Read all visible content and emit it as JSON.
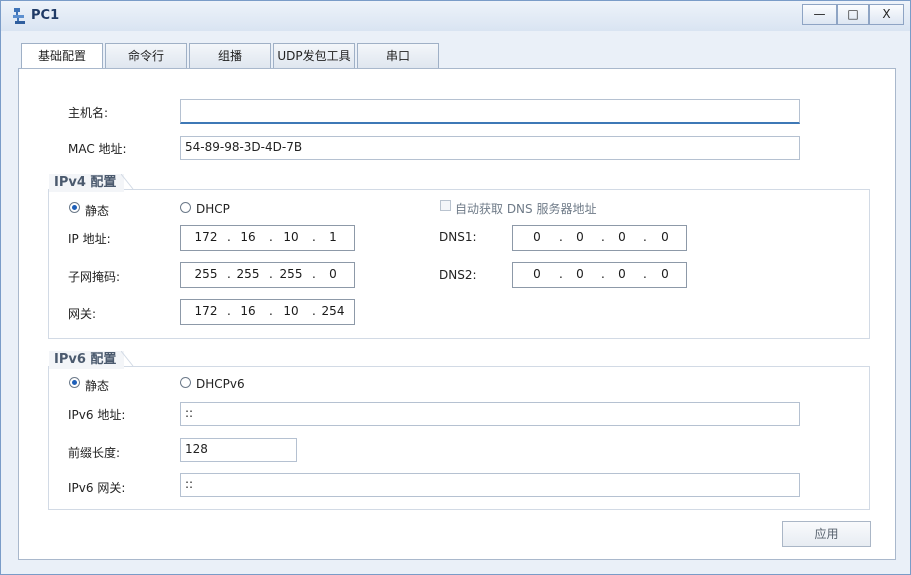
{
  "window": {
    "title": "PC1"
  },
  "tabs": [
    {
      "label": "基础配置",
      "active": true
    },
    {
      "label": "命令行",
      "active": false
    },
    {
      "label": "组播",
      "active": false
    },
    {
      "label": "UDP发包工具",
      "active": false
    },
    {
      "label": "串口",
      "active": false
    }
  ],
  "form": {
    "hostname_label": "主机名:",
    "hostname_value": "",
    "mac_label": "MAC 地址:",
    "mac_value": "54-89-98-3D-4D-7B"
  },
  "ipv4": {
    "title": "IPv4 配置",
    "static_label": "静态",
    "dhcp_label": "DHCP",
    "mode": "static",
    "auto_dns_label": "自动获取 DNS 服务器地址",
    "ip_label": "IP 地址:",
    "ip": [
      "172",
      "16",
      "10",
      "1"
    ],
    "mask_label": "子网掩码:",
    "mask": [
      "255",
      "255",
      "255",
      "0"
    ],
    "gateway_label": "网关:",
    "gateway": [
      "172",
      "16",
      "10",
      "254"
    ],
    "dns1_label": "DNS1:",
    "dns1": [
      "0",
      "0",
      "0",
      "0"
    ],
    "dns2_label": "DNS2:",
    "dns2": [
      "0",
      "0",
      "0",
      "0"
    ]
  },
  "ipv6": {
    "title": "IPv6 配置",
    "static_label": "静态",
    "dhcp_label": "DHCPv6",
    "mode": "static",
    "addr_label": "IPv6 地址:",
    "addr_value": "::",
    "prefix_label": "前缀长度:",
    "prefix_value": "128",
    "gateway_label": "IPv6 网关:",
    "gateway_value": "::"
  },
  "apply_label": "应用",
  "colors": {
    "accent": "#3e78b6",
    "title": "#1f3a66",
    "radio_on": "#1e5fb8"
  }
}
